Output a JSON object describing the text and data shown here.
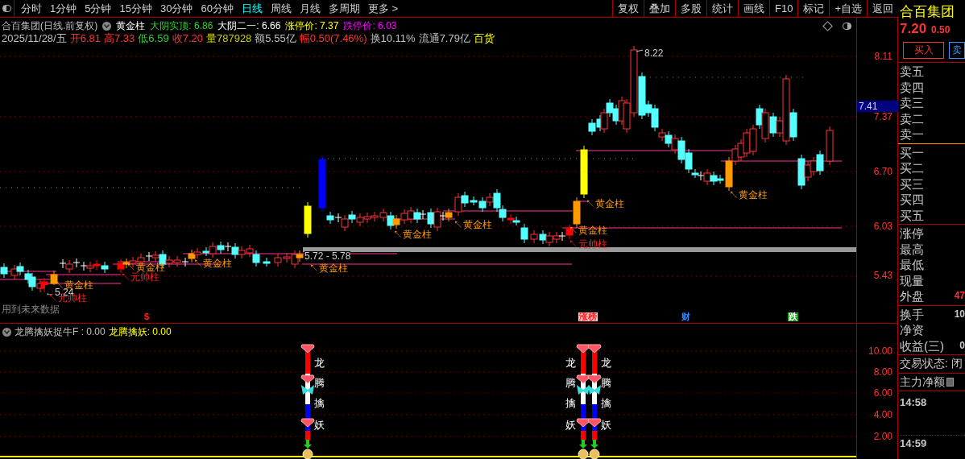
{
  "toolbar": {
    "periods": [
      {
        "label": "分时",
        "selected": false
      },
      {
        "label": "1分钟",
        "selected": false
      },
      {
        "label": "5分钟",
        "selected": false
      },
      {
        "label": "15分钟",
        "selected": false
      },
      {
        "label": "30分钟",
        "selected": false
      },
      {
        "label": "60分钟",
        "selected": false
      },
      {
        "label": "日线",
        "selected": true
      },
      {
        "label": "周线",
        "selected": false
      },
      {
        "label": "月线",
        "selected": false
      },
      {
        "label": "多周期",
        "selected": false
      },
      {
        "label": "更多 >",
        "selected": false
      }
    ],
    "buttons": [
      "复权",
      "叠加",
      "多股",
      "统计",
      "画线",
      "F10",
      "标记",
      "+自选",
      "返回"
    ]
  },
  "info_line_1": [
    {
      "text": "合百集团(日线.前复权)",
      "color": "#c0c0c0"
    },
    {
      "text": "黄金柱",
      "color": "#ffffff"
    },
    {
      "text": "大阴实顶: 6.86",
      "color": "#33cc33"
    },
    {
      "text": "大阴二一: 6.66",
      "color": "#ffffff"
    },
    {
      "text": "涨停价: 7.37",
      "color": "#ffff00"
    },
    {
      "text": "跌停价: 6.03",
      "color": "#ff00ff"
    }
  ],
  "info_line_2": [
    {
      "text": "2025/11/28/五",
      "color": "#c0c0c0"
    },
    {
      "text": "开6.81",
      "color": "#ff3333"
    },
    {
      "text": "高7.33",
      "color": "#ff3333"
    },
    {
      "text": "低6.59",
      "color": "#33cc33"
    },
    {
      "text": "收7.20",
      "color": "#ff3333"
    },
    {
      "text": "量787928",
      "color": "#cccc00"
    },
    {
      "text": "额5.55亿",
      "color": "#c0c0c0"
    },
    {
      "text": "幅0.50(7.46%)",
      "color": "#ff3333"
    },
    {
      "text": "换10.11%",
      "color": "#c0c0c0"
    },
    {
      "text": "流通7.79亿",
      "color": "#c0c0c0"
    },
    {
      "text": "百货",
      "color": "#ffff00"
    }
  ],
  "chart": {
    "high_label": "8.22",
    "range_label": "5.72 - 5.78",
    "low_label": "←5.24",
    "note": "用到未来数据",
    "annotations": [
      {
        "text": "↖黄金柱",
        "kind": "gold"
      },
      {
        "text": "↖元帅柱",
        "kind": "marshal"
      },
      {
        "text": "↖黄金柱",
        "kind": "gold"
      },
      {
        "text": "↖元帅柱",
        "kind": "marshal"
      },
      {
        "text": "↖黄金柱",
        "kind": "gold"
      },
      {
        "text": "↖黄金柱",
        "kind": "gold"
      },
      {
        "text": "↖黄金柱",
        "kind": "gold"
      },
      {
        "text": "↖黄金柱",
        "kind": "gold"
      },
      {
        "text": "↖黄金柱",
        "kind": "gold"
      },
      {
        "text": "↖黄金柱",
        "kind": "gold"
      },
      {
        "text": "↖元帅柱",
        "kind": "marshal"
      },
      {
        "text": "↖黄金柱",
        "kind": "gold"
      }
    ],
    "event_markers": [
      {
        "text": "$",
        "kind": "dollar"
      },
      {
        "text": "涨榜",
        "kind": "up"
      },
      {
        "text": "财",
        "kind": "finance"
      },
      {
        "text": "跌",
        "kind": "down"
      }
    ]
  },
  "price_axis": [
    {
      "text": "8.11",
      "kind": "tick"
    },
    {
      "text": "7.41",
      "kind": "current"
    },
    {
      "text": "7.37",
      "kind": "tick"
    },
    {
      "text": "6.70",
      "kind": "tick"
    },
    {
      "text": "6.03",
      "kind": "tick"
    },
    {
      "text": "5.43",
      "kind": "tick"
    }
  ],
  "indicator": {
    "name": "龙腾擒妖捉牛F : 0.00",
    "value": "龙腾擒妖: 0.00",
    "axis": [
      "10.00",
      "8.00",
      "6.00",
      "4.00",
      "2.00"
    ],
    "signals": [
      {
        "labels": [
          "龙",
          "腾",
          "擒",
          "妖"
        ]
      },
      {
        "labels": [
          "龙",
          "腾",
          "擒",
          "妖"
        ]
      },
      {
        "labels": [
          "龙",
          "腾",
          "擒",
          "妖"
        ]
      }
    ]
  },
  "quote": {
    "name": "合百集团",
    "price": "7.20",
    "change": "0.50",
    "buy_button": "买入",
    "sell_button": "卖",
    "sections": [
      [
        {
          "label": "卖五"
        },
        {
          "label": "卖四"
        },
        {
          "label": "卖三"
        },
        {
          "label": "卖二"
        },
        {
          "label": "卖一"
        }
      ],
      [
        {
          "label": "买一"
        },
        {
          "label": "买二"
        },
        {
          "label": "买三"
        },
        {
          "label": "买四"
        },
        {
          "label": "买五"
        }
      ],
      [
        {
          "label": "涨停"
        },
        {
          "label": "最高"
        },
        {
          "label": "最低"
        },
        {
          "label": "现量"
        },
        {
          "label": "外盘",
          "value": "47"
        }
      ],
      [
        {
          "label": "换手",
          "value": "10"
        },
        {
          "label": "净资"
        },
        {
          "label": "收益(三)",
          "value": "0"
        }
      ]
    ],
    "status": "交易状态: 闭",
    "net_flow": "主力净额",
    "times": [
      "14:58",
      "14:59"
    ]
  }
}
